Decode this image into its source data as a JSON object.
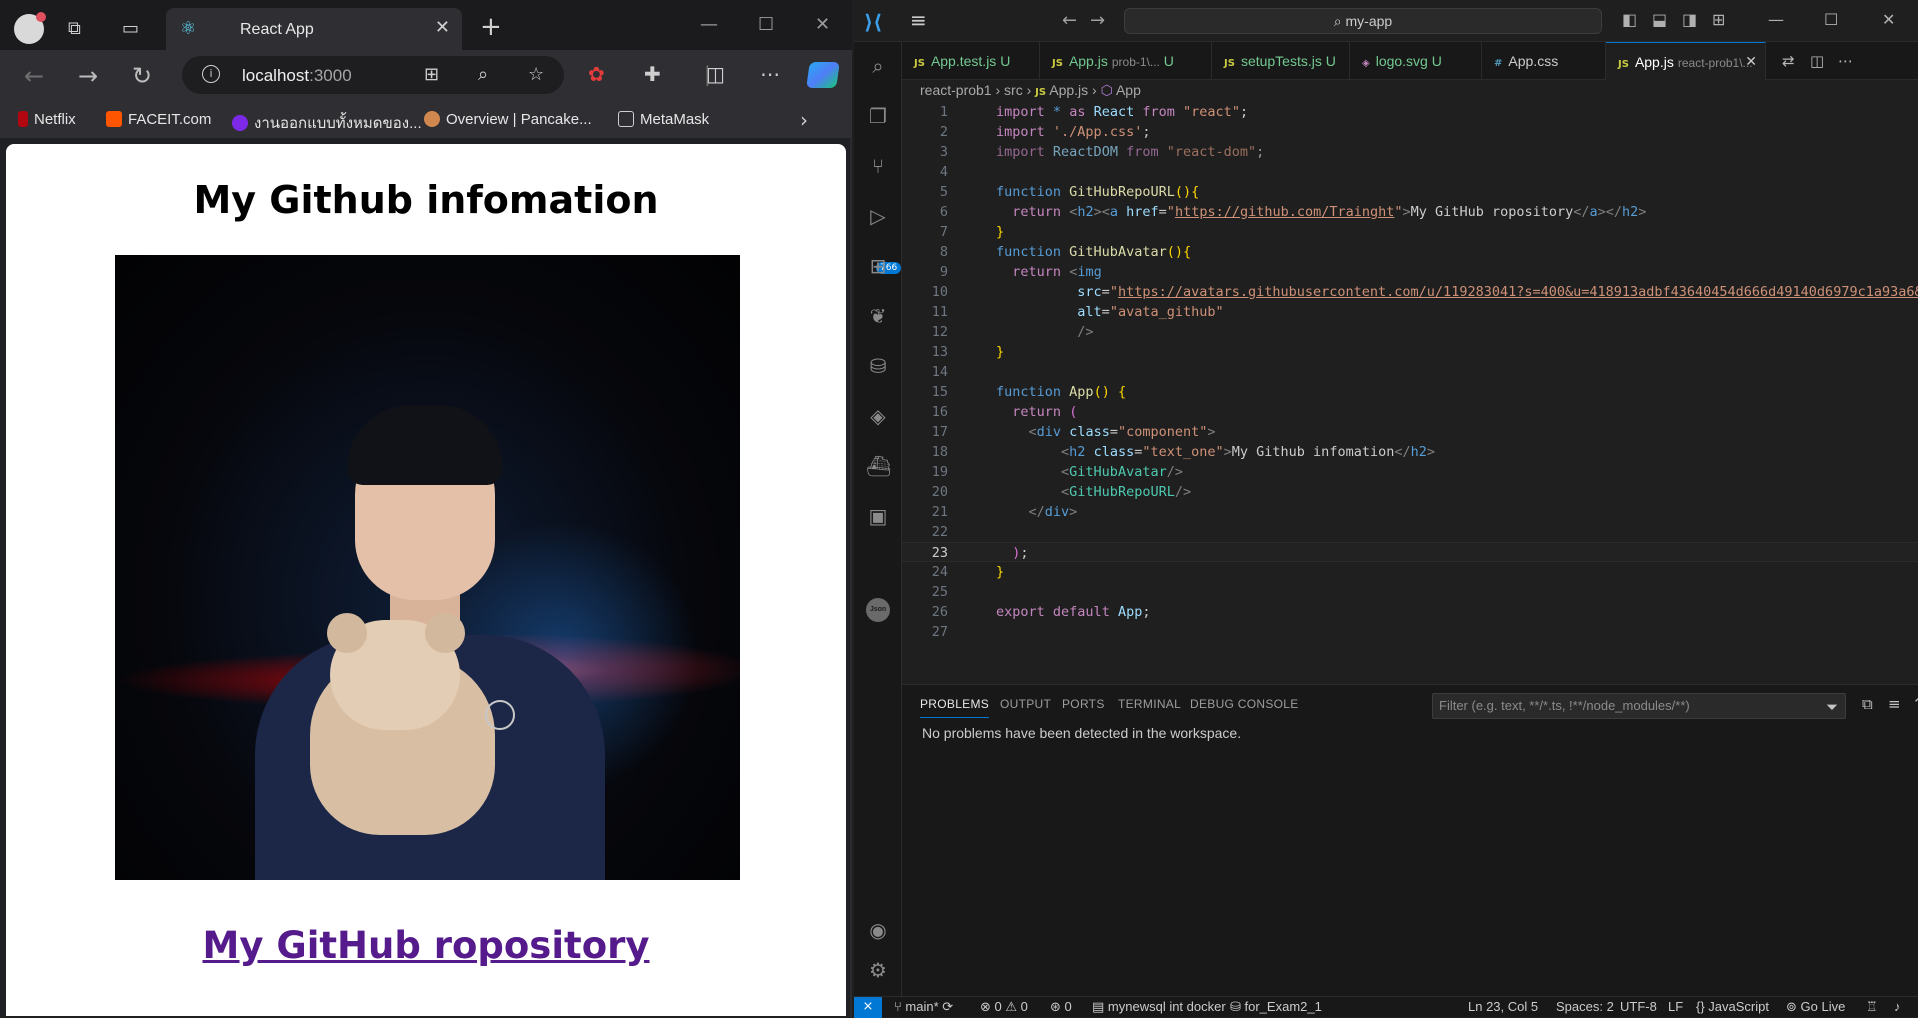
{
  "browser": {
    "tab_title": "React App",
    "url_host": "localhost",
    "url_port": ":3000",
    "bookmarks": [
      "Netflix",
      "FACEIT.com",
      "งานออกแบบทั้งหมดของ...",
      "Overview | Pancake...",
      "MetaMask"
    ],
    "page": {
      "heading": "My Github infomation",
      "avatar_alt": "avata_github",
      "repo_link_text": "My GitHub ropository"
    }
  },
  "vscode": {
    "search_text": "my-app",
    "tabs": [
      {
        "label": "App.test.js",
        "badge": "U",
        "color": "#73c991"
      },
      {
        "label": "App.js",
        "sub": "prob-1\\...",
        "badge": "U",
        "color": "#73c991"
      },
      {
        "label": "setupTests.js",
        "badge": "U",
        "color": "#73c991"
      },
      {
        "label": "logo.svg",
        "badge": "U",
        "color": "#73c991"
      },
      {
        "label": "App.css",
        "badge": "",
        "color": "#cccccc"
      },
      {
        "label": "App.js",
        "sub": "react-prob1\\...",
        "badge": "",
        "color": "#ffffff"
      }
    ],
    "breadcrumb": {
      "root": "react-prob1",
      "folder": "src",
      "file": "App.js",
      "symbol": "App"
    },
    "activity_badge": "766",
    "code_lines": [
      "1",
      "2",
      "3",
      "4",
      "5",
      "6",
      "7",
      "8",
      "9",
      "10",
      "11",
      "12",
      "13",
      "14",
      "15",
      "16",
      "17",
      "18",
      "19",
      "20",
      "21",
      "22",
      "23",
      "24",
      "25",
      "26",
      "27"
    ],
    "panel": {
      "tabs": [
        "PROBLEMS",
        "OUTPUT",
        "PORTS",
        "TERMINAL",
        "DEBUG CONSOLE"
      ],
      "filter_placeholder": "Filter (e.g. text, **/*.ts, !**/node_modules/**)",
      "message": "No problems have been detected in the workspace."
    },
    "status": {
      "branch": "main*",
      "errors": "0",
      "warnings": "0",
      "ports": "0",
      "db": "mynewsql int docker",
      "db2": "for_Exam2_1",
      "position": "Ln 23, Col 5",
      "spaces": "Spaces: 2",
      "encoding": "UTF-8",
      "eol": "LF",
      "language": "JavaScript",
      "golive": "Go Live"
    }
  }
}
